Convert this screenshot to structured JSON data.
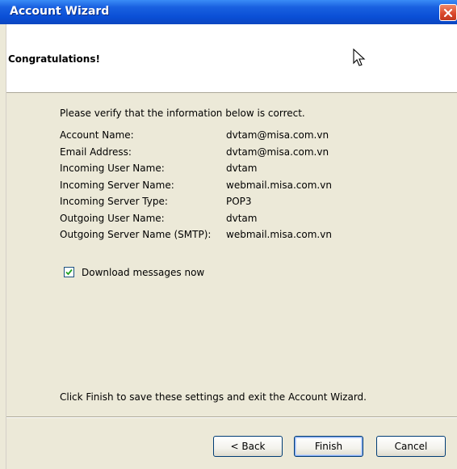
{
  "window": {
    "title": "Account Wizard"
  },
  "header": {
    "title": "Congratulations!"
  },
  "content": {
    "intro": "Please verify that the information below is correct.",
    "fields": [
      {
        "label": "Account Name:",
        "value": "dvtam@misa.com.vn"
      },
      {
        "label": "Email Address:",
        "value": "dvtam@misa.com.vn"
      },
      {
        "label": "Incoming User Name:",
        "value": "dvtam"
      },
      {
        "label": "Incoming Server Name:",
        "value": "webmail.misa.com.vn"
      },
      {
        "label": "Incoming Server Type:",
        "value": "POP3"
      },
      {
        "label": "Outgoing User Name:",
        "value": "dvtam"
      },
      {
        "label": "Outgoing Server Name (SMTP):",
        "value": "webmail.misa.com.vn"
      }
    ],
    "download_checkbox": {
      "label": "Download messages now",
      "checked": true
    },
    "footer_text": "Click Finish to save these settings and exit the Account Wizard."
  },
  "buttons": {
    "back": "< Back",
    "finish": "Finish",
    "cancel": "Cancel"
  },
  "icons": {
    "close": "close-icon",
    "checkmark": "checkmark-icon",
    "cursor": "mouse-pointer-icon"
  }
}
